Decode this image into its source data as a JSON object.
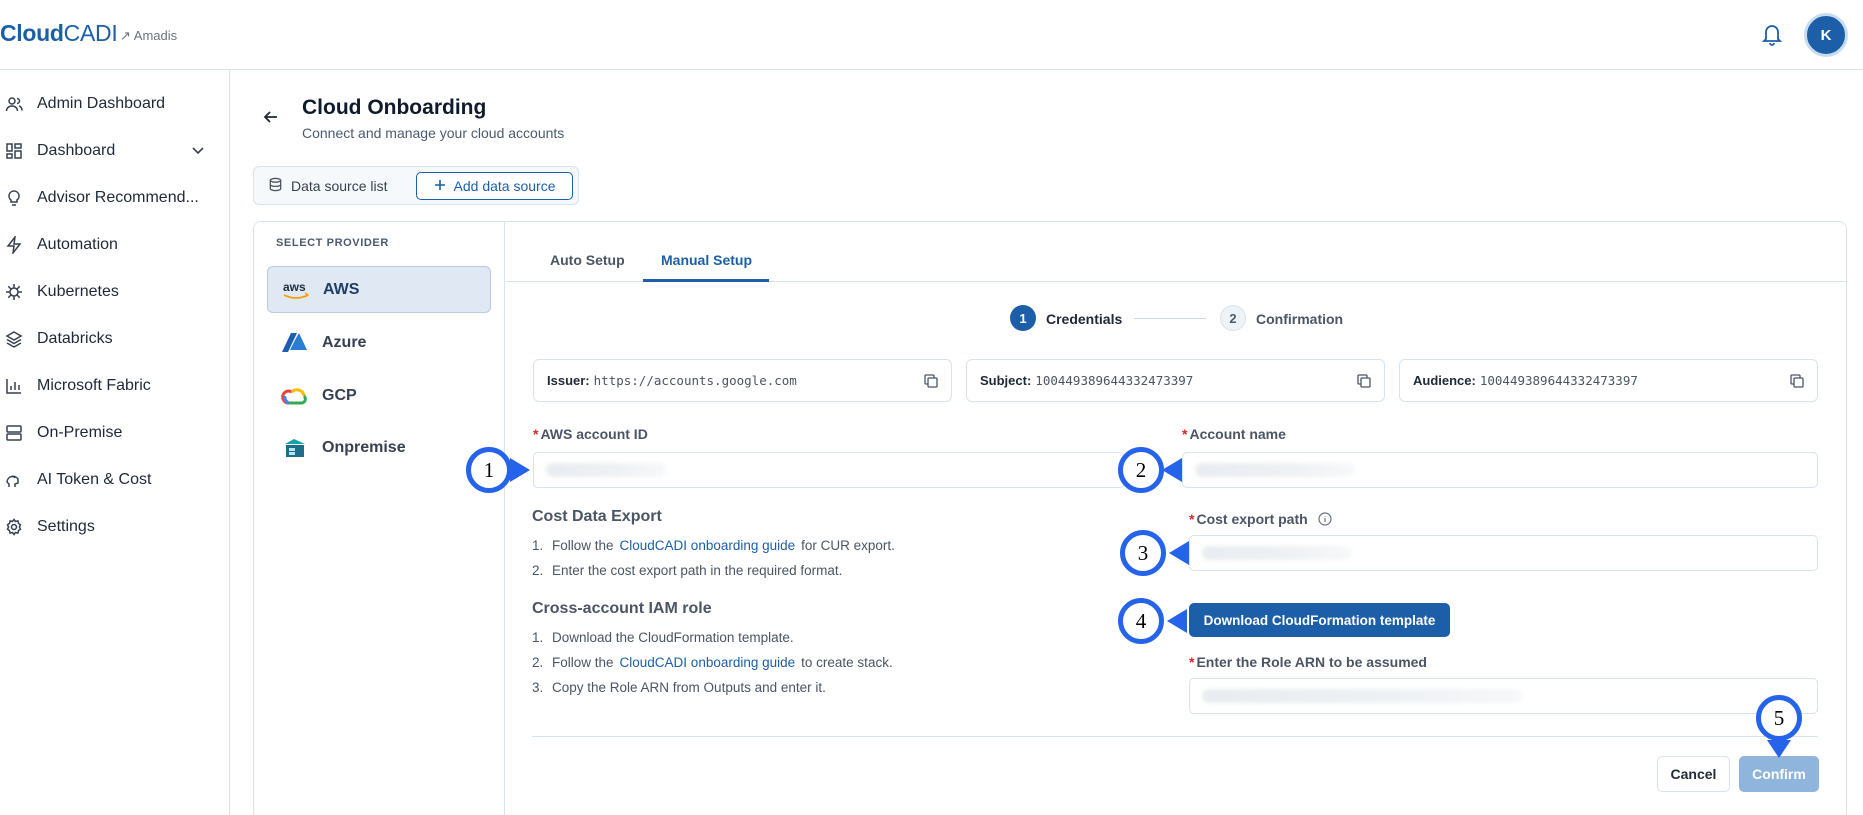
{
  "app": {
    "logo_bold": "Cloud",
    "logo_light": "CADI",
    "org": "↗ Amadis",
    "avatar_initial": "K",
    "accent": "#1c5fa8"
  },
  "sidebar": {
    "items": [
      {
        "label": "Admin Dashboard",
        "icon": "users-icon"
      },
      {
        "label": "Dashboard",
        "icon": "grid-icon"
      },
      {
        "label": "Advisor Recommend...",
        "icon": "lightbulb-icon"
      },
      {
        "label": "Automation",
        "icon": "bolt-icon"
      },
      {
        "label": "Kubernetes",
        "icon": "helm-icon"
      },
      {
        "label": "Databricks",
        "icon": "layers-icon"
      },
      {
        "label": "Microsoft Fabric",
        "icon": "bar-chart-icon"
      },
      {
        "label": "On-Premise",
        "icon": "server-icon"
      },
      {
        "label": "AI Token & Cost",
        "icon": "brain-icon"
      },
      {
        "label": "Settings",
        "icon": "gear-icon"
      }
    ]
  },
  "page": {
    "title": "Cloud Onboarding",
    "subtitle": "Connect and manage your cloud accounts",
    "segment_list": "Data source list",
    "segment_add": "Add data source"
  },
  "providers": {
    "heading": "SELECT PROVIDER",
    "items": [
      {
        "label": "AWS",
        "selected": true
      },
      {
        "label": "Azure",
        "selected": false
      },
      {
        "label": "GCP",
        "selected": false
      },
      {
        "label": "Onpremise",
        "selected": false
      }
    ],
    "aws_badge": "aws"
  },
  "tabs": {
    "auto": "Auto Setup",
    "manual": "Manual Setup",
    "active": "Manual Setup"
  },
  "stepper": {
    "step1_num": "1",
    "step1_label": "Credentials",
    "step2_num": "2",
    "step2_label": "Confirmation"
  },
  "info": {
    "issuer_key": "Issuer:",
    "issuer_val": "https://accounts.google.com",
    "subject_key": "Subject:",
    "subject_val": "100449389644332473397",
    "audience_key": "Audience:",
    "audience_val": "100449389644332473397"
  },
  "form": {
    "aws_account_id_label": "AWS account ID",
    "account_name_label": "Account name",
    "cost_export_path_label": "Cost export path",
    "role_arn_label": "Enter the Role ARN to be assumed",
    "required_mark": "*",
    "download_button": "Download CloudFormation template",
    "cancel_button": "Cancel",
    "confirm_button": "Confirm"
  },
  "instructions": {
    "cost_title": "Cost Data Export",
    "cost_1_num": "1.",
    "cost_1_pre": "Follow the",
    "cost_1_link": "CloudCADI onboarding guide",
    "cost_1_post": "for CUR export.",
    "cost_2_num": "2.",
    "cost_2": "Enter the cost export path in the required format.",
    "iam_title": "Cross-account IAM role",
    "iam_1_num": "1.",
    "iam_1": "Download the CloudFormation template.",
    "iam_2_num": "2.",
    "iam_2_pre": "Follow the",
    "iam_2_link": "CloudCADI onboarding guide",
    "iam_2_post": "to create stack.",
    "iam_3_num": "3.",
    "iam_3": "Copy the Role ARN from Outputs and enter it."
  },
  "markers": {
    "m1": "1",
    "m2": "2",
    "m3": "3",
    "m4": "4",
    "m5": "5",
    "color": "#2563eb"
  }
}
